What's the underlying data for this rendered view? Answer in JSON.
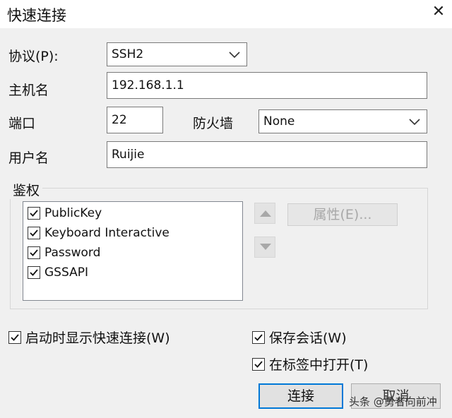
{
  "window": {
    "title": "快速连接",
    "close_glyph": "✕"
  },
  "form": {
    "protocol_label": "协议(P):",
    "protocol_value": "SSH2",
    "hostname_label": "主机名",
    "hostname_value": "192.168.1.1",
    "port_label": "端口",
    "port_value": "22",
    "firewall_label": "防火墙",
    "firewall_value": "None",
    "username_label": "用户名",
    "username_value": "Ruijie"
  },
  "auth": {
    "group_label": "鉴权",
    "methods": [
      {
        "label": "PublicKey",
        "checked": true
      },
      {
        "label": "Keyboard Interactive",
        "checked": true
      },
      {
        "label": "Password",
        "checked": true
      },
      {
        "label": "GSSAPI",
        "checked": true
      }
    ],
    "properties_label": "属性(E)..."
  },
  "options": {
    "show_on_startup": {
      "label": "启动时显示快速连接(W)",
      "checked": true
    },
    "save_session": {
      "label": "保存会话(W)",
      "checked": true
    },
    "open_in_tab": {
      "label": "在标签中打开(T)",
      "checked": true
    }
  },
  "buttons": {
    "connect": "连接",
    "cancel": "取消"
  },
  "watermark": "头条 @勇者向前冲",
  "colors": {
    "accent": "#0078d7"
  }
}
